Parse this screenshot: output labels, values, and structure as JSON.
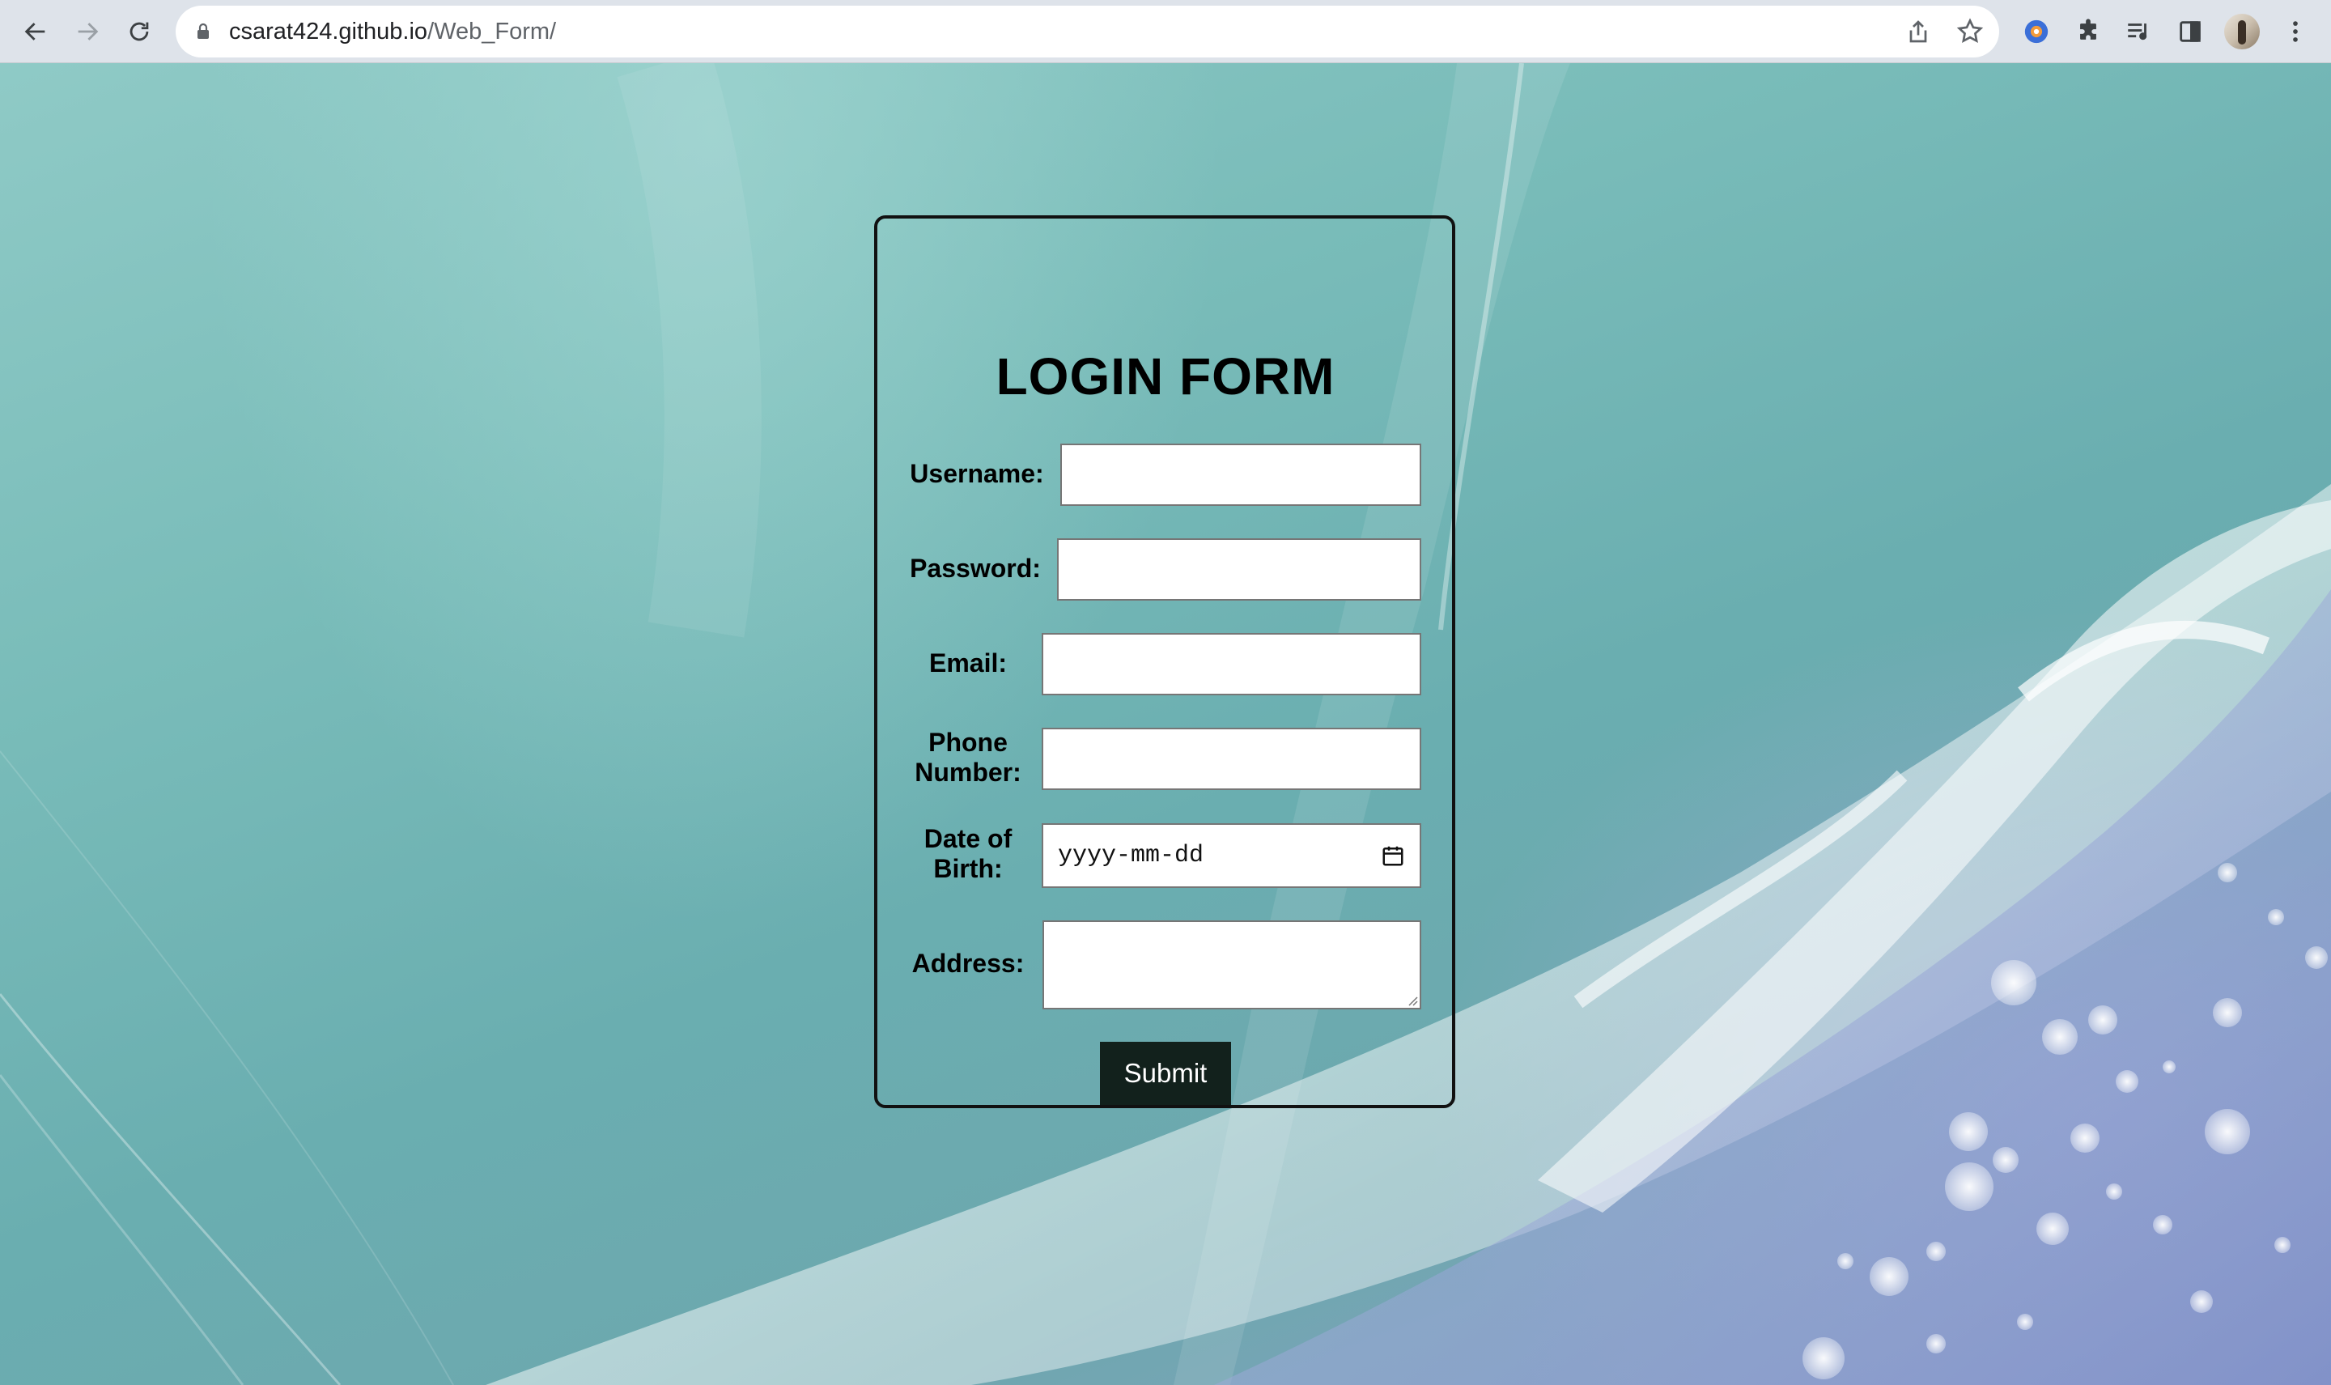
{
  "browser": {
    "url_host": "csarat424.github.io",
    "url_path": "/Web_Form/",
    "icons": {
      "back": "arrow-left-icon",
      "forward": "arrow-right-icon",
      "reload": "reload-icon",
      "lock": "lock-icon",
      "share": "share-icon",
      "bookmark": "star-icon",
      "extension_1": "circle-extension-icon",
      "extensions": "puzzle-icon",
      "media": "media-queue-icon",
      "side_panel": "side-panel-icon",
      "profile": "avatar",
      "menu": "kebab-menu-icon"
    }
  },
  "form": {
    "title": "LOGIN FORM",
    "fields": {
      "username": {
        "label": "Username:",
        "value": ""
      },
      "password": {
        "label": "Password:",
        "value": ""
      },
      "email": {
        "label": "Email:",
        "value": ""
      },
      "phone": {
        "label_line1": "Phone",
        "label_line2": "Number:",
        "value": ""
      },
      "dob": {
        "label_line1": "Date of",
        "label_line2": "Birth:",
        "placeholder": "yyyy-mm-dd"
      },
      "address": {
        "label": "Address:",
        "value": ""
      }
    },
    "submit_label": "Submit"
  },
  "colors": {
    "card_border": "#111111",
    "submit_background": "#12211c",
    "submit_text": "#ffffff",
    "background_teal": "#79bcb9"
  }
}
